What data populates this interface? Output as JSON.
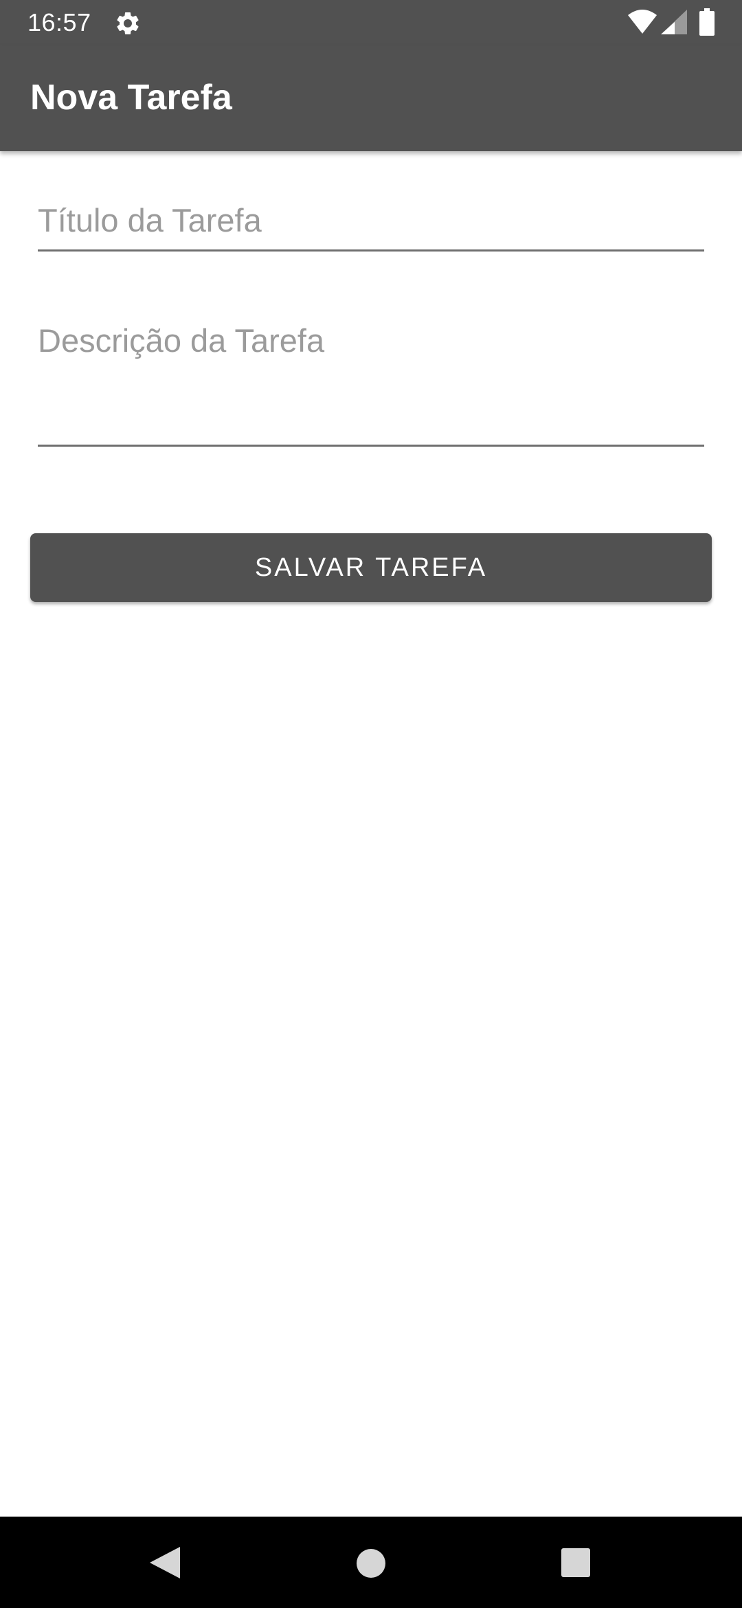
{
  "status_bar": {
    "time": "16:57",
    "icons": [
      "gear-icon",
      "wifi-icon",
      "cell-signal-icon",
      "battery-icon"
    ]
  },
  "app_bar": {
    "title": "Nova Tarefa"
  },
  "form": {
    "title_field": {
      "placeholder": "Título da Tarefa",
      "value": ""
    },
    "description_field": {
      "placeholder": "Descrição da Tarefa",
      "value": ""
    },
    "save_label": "SALVAR TAREFA"
  },
  "nav_bar": {
    "icons": [
      "back-icon",
      "home-icon",
      "recents-icon"
    ]
  },
  "colors": {
    "primary": "#515151",
    "background": "#ffffff",
    "hint_text": "#9b9b9b",
    "nav_background": "#000000"
  }
}
